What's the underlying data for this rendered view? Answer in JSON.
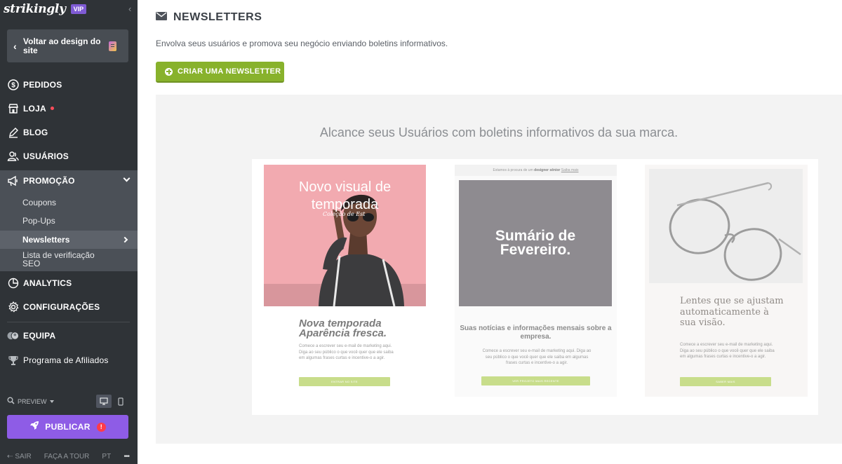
{
  "sidebar": {
    "brand": "strikingly",
    "vip_badge": "VIP",
    "back_button": "Voltar ao design do site",
    "nav": {
      "orders": "PEDIDOS",
      "store": "LOJA",
      "blog": "BLOG",
      "users": "USUÁRIOS",
      "promotion": "PROMOÇÃO",
      "analytics": "ANALYTICS",
      "settings": "CONFIGURAÇÕES",
      "team": "EQUIPA",
      "affiliates": "Programa de Afiliados"
    },
    "promotion_items": {
      "coupons": "Coupons",
      "popups": "Pop-Ups",
      "newsletters": "Newsletters",
      "seo": "Lista de verificação SEO"
    },
    "preview_label": "PREVIEW",
    "publish_label": "PUBLICAR",
    "publish_alert": "!",
    "footer": {
      "logout": "SAIR",
      "tour": "FAÇA A TOUR",
      "language": "PT",
      "more": "•••"
    }
  },
  "main": {
    "title": "NEWSLETTERS",
    "description": "Envolva seus usuários e promova seu negócio enviando boletins informativos.",
    "create_button": "CRIAR UMA NEWSLETTER",
    "tagline": "Alcance seus Usuários com boletins informativos da sua marca.",
    "cards": [
      {
        "hero_title": "Novo visual de temporada",
        "hero_script": "Coleção de Est",
        "headline": "Nova temporada Aparência fresca.",
        "body": "Comece a escrever seu e-mail de marketing aqui. Diga ao seu público o que você quer que ele saiba em algumas frases curtas e incentive-o a agir.",
        "button": "ENTRAR NO SITE"
      },
      {
        "top_bar_prefix": "Estamos à procura de um",
        "top_bar_bold": "designer sênior",
        "top_bar_link": "Saiba mais",
        "hero_title": "Sumário de Fevereiro.",
        "headline": "Suas notícias e informações mensais sobre a empresa.",
        "body": "Comece a escrever seu e-mail de marketing aqui. Diga ao seu público o que você quer que ele saiba em algumas frases curtas e incentive-o a agir.",
        "button": "VER PROJETO MAIS RECENTE"
      },
      {
        "headline": "Lentes que se ajustam automaticamente à sua visão.",
        "body": "Comece a escrever seu e-mail de marketing aqui. Diga ao seu público o que você quer que ele saiba em algumas frases curtas e incentive-o a agir.",
        "button": "SABER MAIS"
      }
    ]
  },
  "colors": {
    "sidebar_bg": "#2f3337",
    "promo_group_bg": "#4b5057",
    "accent_green": "#88b22c",
    "publish_purple": "#8e5ce6",
    "vip_purple": "#7f5bd4",
    "alert_red": "#ff3b4a",
    "card1_hero": "#f2aab0",
    "card2_hero": "#8e8b90"
  },
  "icons": [
    "chevron-left-icon",
    "page-icon",
    "dollar-circle-icon",
    "store-icon",
    "pen-icon",
    "users-icon",
    "megaphone-icon",
    "chevron-down-icon",
    "chevron-right-icon",
    "pie-chart-icon",
    "gear-icon",
    "team-avatar-icon",
    "trophy-icon",
    "search-icon",
    "desktop-icon",
    "mobile-icon",
    "rocket-icon",
    "logout-icon",
    "envelope-icon",
    "plus-circle-icon"
  ]
}
